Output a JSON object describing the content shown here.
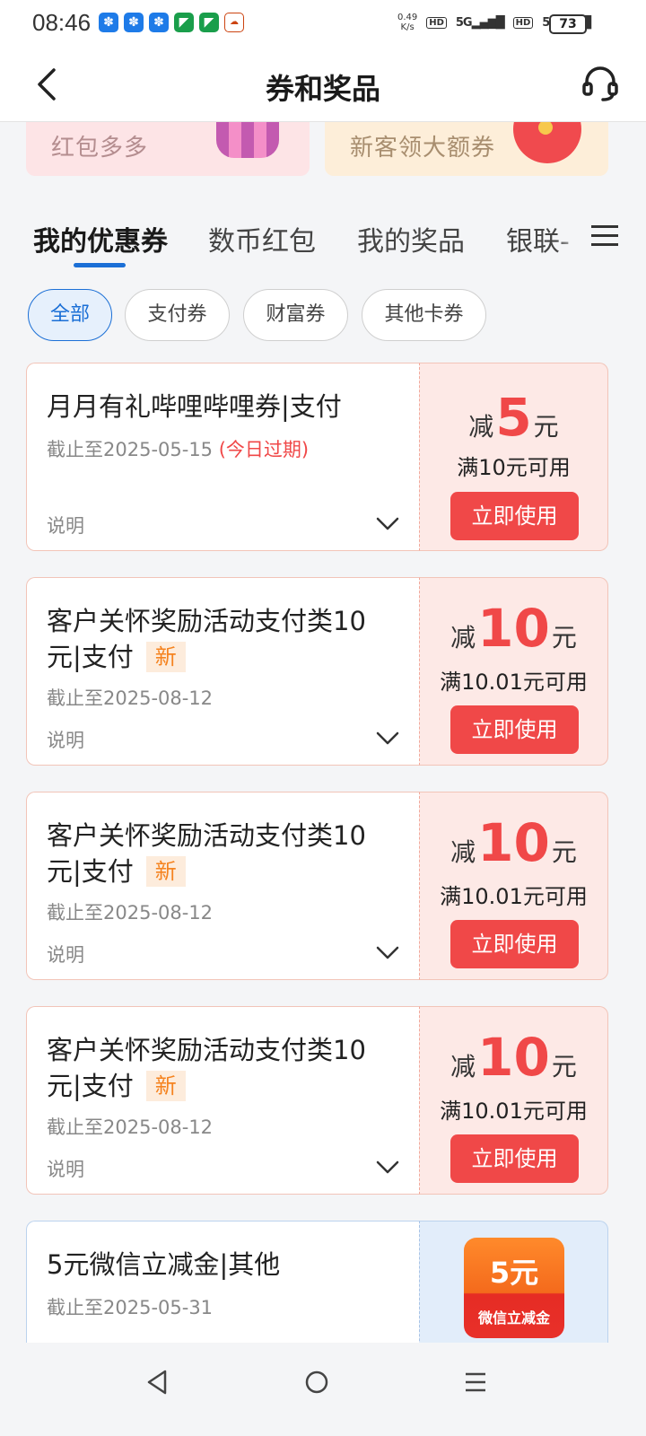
{
  "status_bar": {
    "time": "08:46",
    "net_speed_value": "0.49",
    "net_speed_unit": "K/s",
    "hd_1": "HD",
    "signal_1": "5G",
    "hd_2": "HD",
    "signal_2": "5G",
    "battery": "73"
  },
  "header": {
    "title": "券和奖品",
    "back_icon": "chevron-left-icon",
    "service_icon": "headset-icon"
  },
  "banners": [
    {
      "text": "红包多多"
    },
    {
      "text": "新客领大额券"
    }
  ],
  "tabs": [
    {
      "label": "我的优惠券",
      "active": true
    },
    {
      "label": "数币红包"
    },
    {
      "label": "我的奖品"
    },
    {
      "label": "银联-"
    }
  ],
  "chips": [
    {
      "label": "全部",
      "active": true
    },
    {
      "label": "支付券"
    },
    {
      "label": "财富券"
    },
    {
      "label": "其他卡券"
    }
  ],
  "coupons": [
    {
      "title": "月月有礼哔哩哔哩券|支付",
      "date": "截止至2025-05-15",
      "expire_note": "(今日过期)",
      "desc_label": "说明",
      "prefix": "减",
      "amount": "5",
      "suffix": "元",
      "condition": "满10元可用",
      "button": "立即使用"
    },
    {
      "title": "客户关怀奖励活动支付类10元|支付",
      "badge": "新",
      "date": "截止至2025-08-12",
      "desc_label": "说明",
      "prefix": "减",
      "amount": "10",
      "suffix": "元",
      "condition": "满10.01元可用",
      "button": "立即使用"
    },
    {
      "title": "客户关怀奖励活动支付类10元|支付",
      "badge": "新",
      "date": "截止至2025-08-12",
      "desc_label": "说明",
      "prefix": "减",
      "amount": "10",
      "suffix": "元",
      "condition": "满10.01元可用",
      "button": "立即使用"
    },
    {
      "title": "客户关怀奖励活动支付类10元|支付",
      "badge": "新",
      "date": "截止至2025-08-12",
      "desc_label": "说明",
      "prefix": "减",
      "amount": "10",
      "suffix": "元",
      "condition": "满10.01元可用",
      "button": "立即使用"
    },
    {
      "title": "5元微信立减金|其他",
      "date": "截止至2025-05-31",
      "card_amount": "5元",
      "card_label": "微信立减金"
    }
  ],
  "nav": {
    "back_icon": "triangle-back-icon",
    "home_icon": "circle-home-icon",
    "recents_icon": "menu-lines-icon"
  },
  "colors": {
    "accent_blue": "#1b6fd6",
    "coupon_red": "#f04848",
    "new_badge": "#f5831f"
  }
}
